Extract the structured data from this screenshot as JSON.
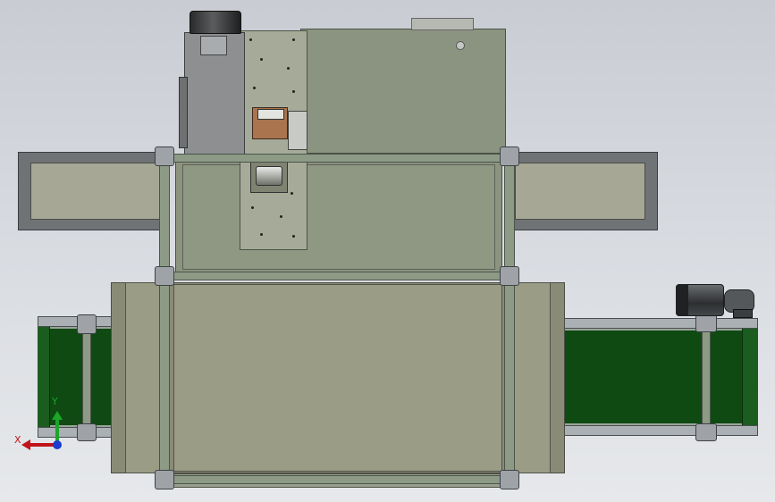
{
  "triad": {
    "x_label": "X",
    "y_label": "Y"
  },
  "colors": {
    "background": "#d7dadf",
    "frame": "#8d9a86",
    "panel": "#9a9c85",
    "belt": "#0f4a12",
    "x_axis": "#c0151a",
    "y_axis": "#1aa52b",
    "z_axis": "#1a3cd0"
  }
}
